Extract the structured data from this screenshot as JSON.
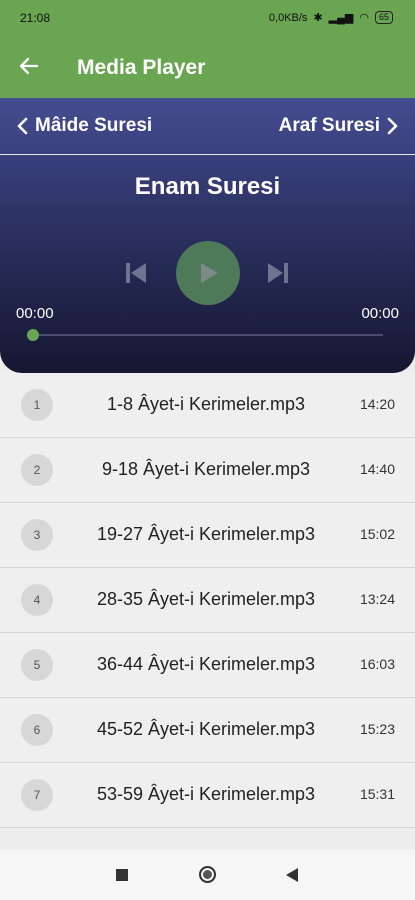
{
  "status": {
    "time": "21:08",
    "network_speed": "0,0KB/s",
    "battery": "65"
  },
  "app_bar": {
    "title": "Media Player",
    "back_icon": "arrow-left-icon"
  },
  "player": {
    "prev_surah": "Mâide Suresi",
    "next_surah": "Araf Suresi",
    "current_title": "Enam Suresi",
    "time_elapsed": "00:00",
    "time_total": "00:00",
    "progress": 0,
    "accent_color": "#6aa552"
  },
  "tracks": [
    {
      "num": "1",
      "name": "1-8 Âyet-i Kerimeler.mp3",
      "duration": "14:20"
    },
    {
      "num": "2",
      "name": "9-18 Âyet-i Kerimeler.mp3",
      "duration": "14:40"
    },
    {
      "num": "3",
      "name": "19-27 Âyet-i Kerimeler.mp3",
      "duration": "15:02"
    },
    {
      "num": "4",
      "name": "28-35 Âyet-i Kerimeler.mp3",
      "duration": "13:24"
    },
    {
      "num": "5",
      "name": "36-44 Âyet-i Kerimeler.mp3",
      "duration": "16:03"
    },
    {
      "num": "6",
      "name": "45-52 Âyet-i Kerimeler.mp3",
      "duration": "15:23"
    },
    {
      "num": "7",
      "name": "53-59 Âyet-i Kerimeler.mp3",
      "duration": "15:31"
    }
  ]
}
